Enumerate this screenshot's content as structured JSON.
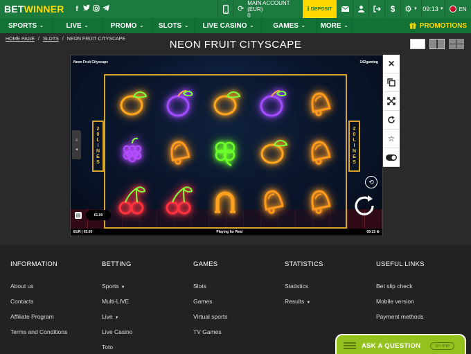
{
  "brand": {
    "bet": "BET",
    "winner": "WINNER"
  },
  "social": [
    "f",
    "t",
    "ig",
    "tg"
  ],
  "topbar": {
    "account_title": "MAIN ACCOUNT (EUR)",
    "account_value": "0",
    "deposit_label": "DEPOSIT",
    "time": "09:13",
    "lang": "EN"
  },
  "nav": {
    "items": [
      {
        "label": "SPORTS"
      },
      {
        "label": "LIVE"
      },
      {
        "label": "PROMO"
      },
      {
        "label": "SLOTS"
      },
      {
        "label": "LIVE CASINO"
      },
      {
        "label": "GAMES"
      },
      {
        "label": "MORE"
      }
    ],
    "promotions": "PROMOTIONS"
  },
  "breadcrumb": {
    "home": "HOME PAGE",
    "slots": "SLOTS",
    "current": "NEON FRUIT CITYSCAPE"
  },
  "page_title": "NEON FRUIT CITYSCAPE",
  "game": {
    "name": "Neon Fruit Cityscape",
    "provider": "1X2gaming",
    "lines_text": [
      "2",
      "0",
      "L",
      "I",
      "N",
      "E",
      "S"
    ],
    "bet_value": "€1.00",
    "footer_balance": "EUR | €0.00",
    "footer_status": "Playing for Real",
    "footer_time": "09:15",
    "symbols": [
      [
        "lemon",
        "plum",
        "lemon",
        "plum",
        "bell"
      ],
      [
        "grapes",
        "bell",
        "clover",
        "lemon",
        "bell"
      ],
      [
        "cherry",
        "cherry",
        "horseshoe",
        "bell",
        "bell"
      ]
    ],
    "colors": {
      "lemon": "#ffa51f",
      "plum": "#a24cff",
      "bell": "#ff9a1f",
      "grapes": "#b44dff",
      "clover": "#6cff2a",
      "cherry": "#ff3340",
      "horseshoe": "#ffa21f"
    }
  },
  "footer": {
    "columns": [
      {
        "title": "INFORMATION",
        "links": [
          {
            "label": "About us"
          },
          {
            "label": "Contacts"
          },
          {
            "label": "Affiliate Program"
          },
          {
            "label": "Terms and Conditions"
          }
        ]
      },
      {
        "title": "BETTING",
        "links": [
          {
            "label": "Sports",
            "caret": true
          },
          {
            "label": "Multi-LIVE"
          },
          {
            "label": "Live",
            "caret": true
          },
          {
            "label": "Live Casino"
          },
          {
            "label": "Toto"
          }
        ]
      },
      {
        "title": "GAMES",
        "links": [
          {
            "label": "Slots"
          },
          {
            "label": "Games"
          },
          {
            "label": "Virtual sports"
          },
          {
            "label": "TV Games"
          }
        ]
      },
      {
        "title": "STATISTICS",
        "links": [
          {
            "label": "Statistics"
          },
          {
            "label": "Results",
            "caret": true
          }
        ]
      },
      {
        "title": "USEFUL LINKS",
        "links": [
          {
            "label": "Bet slip check"
          },
          {
            "label": "Mobile version"
          },
          {
            "label": "Payment methods"
          }
        ]
      }
    ]
  },
  "chat": {
    "label": "ASK A QUESTION",
    "status": "on-line"
  },
  "colors": {
    "brand_green": "#1d7a3e",
    "accent_yellow": "#ffd800",
    "chat_green": "#95c11f"
  }
}
